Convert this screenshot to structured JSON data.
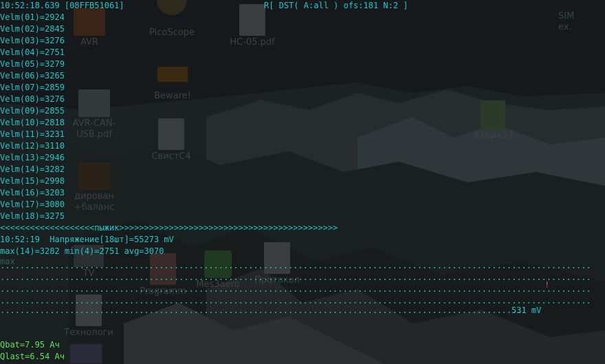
{
  "header": {
    "timestamp": "10:52:18.639 [08FFB51061]",
    "filter": "R[ DST( A:all ) ofs:181 N:2 ]"
  },
  "velm": [
    "Velm(01)=2924",
    "Velm(02)=2845",
    "Velm(03)=3276",
    "Velm(04)=2751",
    "Velm(05)=3279",
    "Velm(06)=3265",
    "Velm(07)=2859",
    "Velm(08)=3276",
    "Velm(09)=2855",
    "Velm(10)=2818",
    "Velm(11)=3231",
    "Velm(12)=3110",
    "Velm(13)=2946",
    "Velm(14)=3282",
    "Velm(15)=2998",
    "Velm(16)=3203",
    "Velm(17)=3080",
    "Velm(18)=3275"
  ],
  "separator": "<<<<<<<<<<<<<<<<<<<пыжик>>>>>>>>>>>>>>>>>>>>>>>>>>>>>>>>>>>>>>>>>>>>",
  "summary": {
    "time_voltage": "10:52:19  Напряжение[18шт]=55273 mV",
    "stats": "max(14)=3282 min(4)=2751 avg=3070",
    "mini": "max"
  },
  "graph": {
    "marker": "!",
    "value_label": "531 mV"
  },
  "battery": {
    "qbat": "Qbat=7.95 Ач",
    "qlast": "Qlast=6.54 Ач"
  },
  "desktop": {
    "icons": [
      {
        "name": "avr-icon",
        "label": "AVR"
      },
      {
        "name": "picoscope-icon",
        "label": "PicoScope"
      },
      {
        "name": "hc05-pdf-icon",
        "label": "HC-05.pdf"
      },
      {
        "name": "beware-icon",
        "label": "Beware!"
      },
      {
        "name": "avr-can-usb-icon",
        "label": "AVR-CAN-USB.pdf"
      },
      {
        "name": "svistc4-icon",
        "label": "СвистС4"
      },
      {
        "name": "sheet-icon",
        "label": "33вых33"
      },
      {
        "name": "balancer-icon",
        "label": "дирован\n+баланс"
      },
      {
        "name": "tv-icon",
        "label": "TV"
      },
      {
        "name": "programs-icon",
        "label": "Programm"
      },
      {
        "name": "green-app-icon",
        "label": "Mes3aero"
      },
      {
        "name": "protocol-icon",
        "label": "Протокол"
      },
      {
        "name": "tech-icon",
        "label": "Технологи"
      },
      {
        "name": "corner-icon",
        "label": "SIM\nex."
      }
    ]
  }
}
